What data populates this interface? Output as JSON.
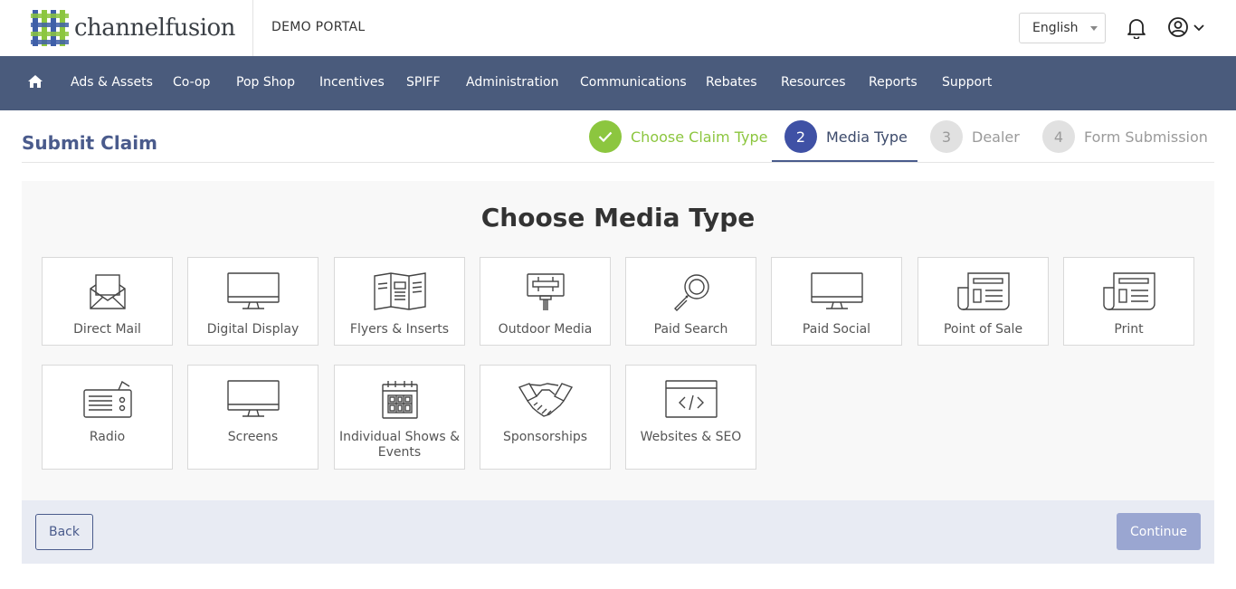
{
  "header": {
    "logo_text": "channelfusion",
    "portal_name": "DEMO PORTAL",
    "language": "English",
    "brand_colors": {
      "nav": "#4a5b7c",
      "accent": "#3f51a5",
      "success": "#8cc63f"
    }
  },
  "nav": {
    "home_icon": "home-icon",
    "items": [
      "Ads & Assets",
      "Co-op",
      "Pop Shop",
      "Incentives",
      "SPIFF",
      "Administration",
      "Communications",
      "Rebates",
      "Resources",
      "Reports",
      "Support"
    ]
  },
  "page": {
    "title": "Submit Claim"
  },
  "steps": [
    {
      "number": "",
      "label": "Choose Claim Type",
      "state": "complete"
    },
    {
      "number": "2",
      "label": "Media Type",
      "state": "active"
    },
    {
      "number": "3",
      "label": "Dealer",
      "state": "pending"
    },
    {
      "number": "4",
      "label": "Form Submission",
      "state": "pending"
    }
  ],
  "main": {
    "heading": "Choose Media Type",
    "media_types": [
      {
        "label": "Direct Mail",
        "icon": "envelope-icon"
      },
      {
        "label": "Digital Display",
        "icon": "monitor-icon"
      },
      {
        "label": "Flyers & Inserts",
        "icon": "brochure-icon"
      },
      {
        "label": "Outdoor Media",
        "icon": "billboard-icon"
      },
      {
        "label": "Paid Search",
        "icon": "magnifier-icon"
      },
      {
        "label": "Paid Social",
        "icon": "monitor-icon"
      },
      {
        "label": "Point of Sale",
        "icon": "newspaper-icon"
      },
      {
        "label": "Print",
        "icon": "newspaper-icon"
      },
      {
        "label": "Radio",
        "icon": "radio-icon"
      },
      {
        "label": "Screens",
        "icon": "monitor-icon"
      },
      {
        "label": "Individual Shows & Events",
        "icon": "calendar-icon"
      },
      {
        "label": "Sponsorships",
        "icon": "handshake-icon"
      },
      {
        "label": "Websites & SEO",
        "icon": "code-window-icon"
      }
    ]
  },
  "footer": {
    "back_label": "Back",
    "continue_label": "Continue"
  }
}
